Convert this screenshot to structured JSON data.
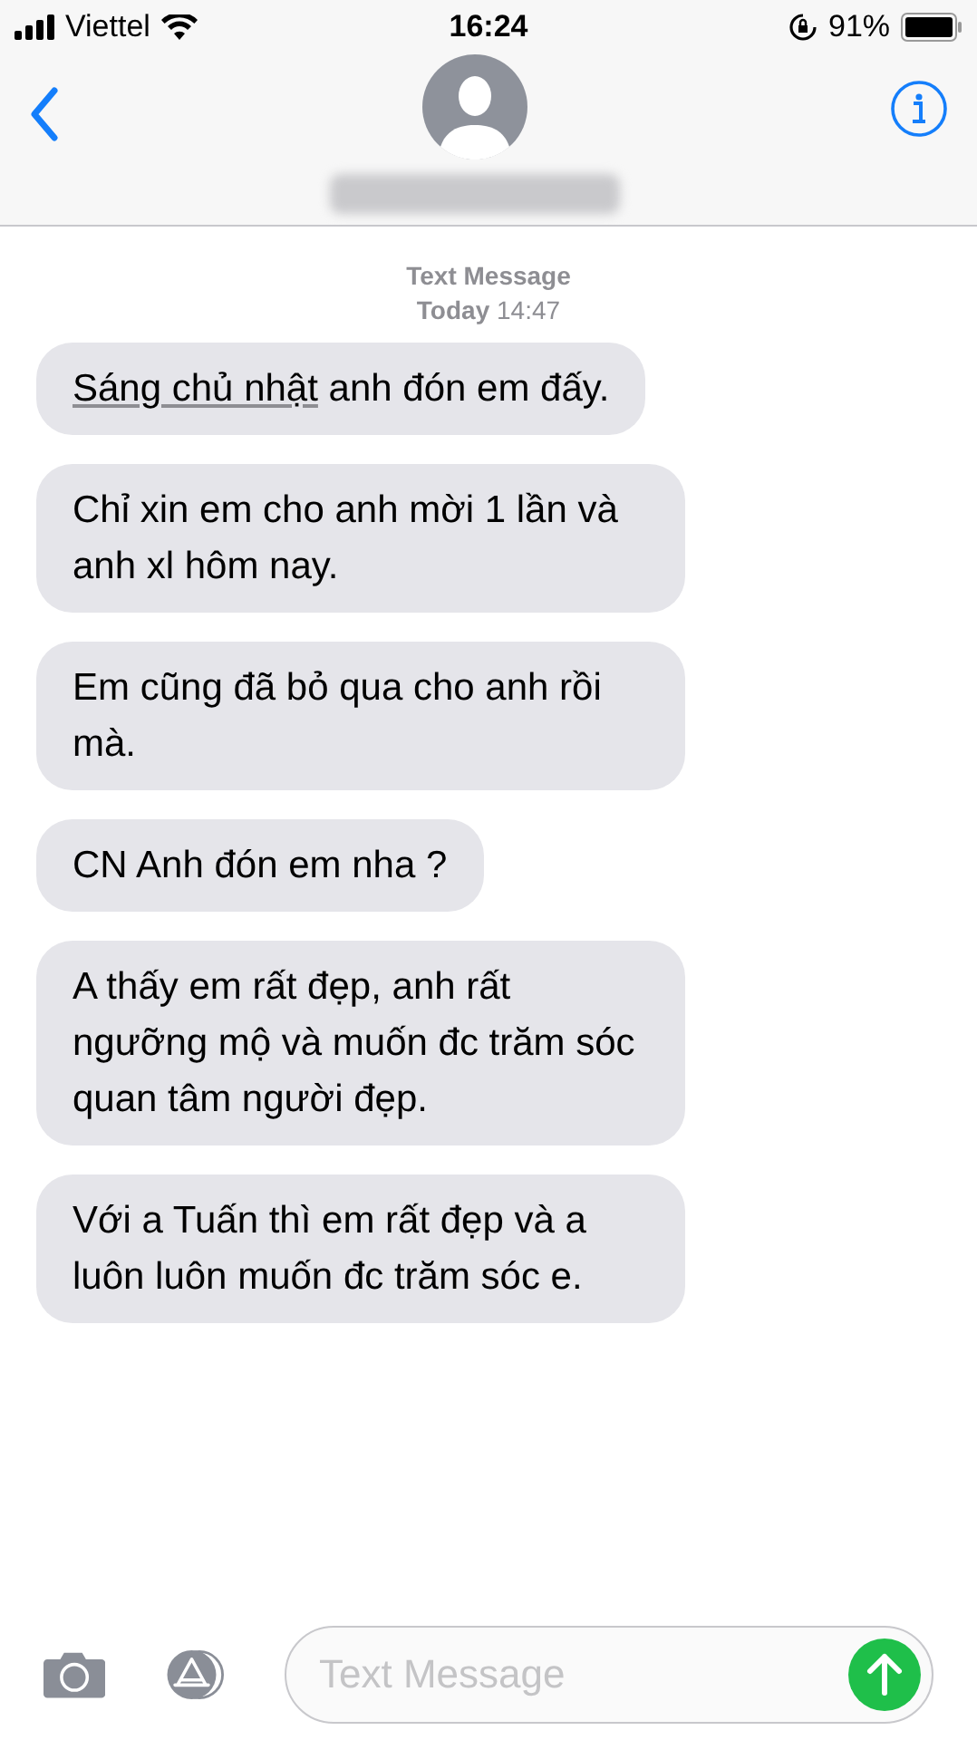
{
  "status_bar": {
    "carrier": "Viettel",
    "time": "16:24",
    "battery": "91%"
  },
  "conversation": {
    "service": "Text Message",
    "timestamp_day": "Today",
    "timestamp_time": "14:47"
  },
  "messages": [
    {
      "parts": [
        {
          "kind": "link",
          "text": "Sáng chủ nhật"
        },
        {
          "kind": "plain",
          "text": " anh đón em đấy."
        }
      ]
    },
    {
      "parts": [
        {
          "kind": "plain",
          "text": "Chỉ xin em cho anh mời 1 lần và anh xl hôm nay."
        }
      ]
    },
    {
      "parts": [
        {
          "kind": "plain",
          "text": "Em cũng đã bỏ qua cho anh rồi mà."
        }
      ]
    },
    {
      "parts": [
        {
          "kind": "plain",
          "text": "CN Anh đón em nha ?"
        }
      ]
    },
    {
      "parts": [
        {
          "kind": "plain",
          "text": "A thấy em rất đẹp, anh rất ngưỡng mộ và muốn đc trăm sóc quan tâm người đẹp."
        }
      ]
    },
    {
      "parts": [
        {
          "kind": "plain",
          "text": "Với a Tuấn thì em rất đẹp và a luôn luôn muốn đc trăm sóc e."
        }
      ]
    }
  ],
  "composer": {
    "placeholder": "Text Message"
  }
}
